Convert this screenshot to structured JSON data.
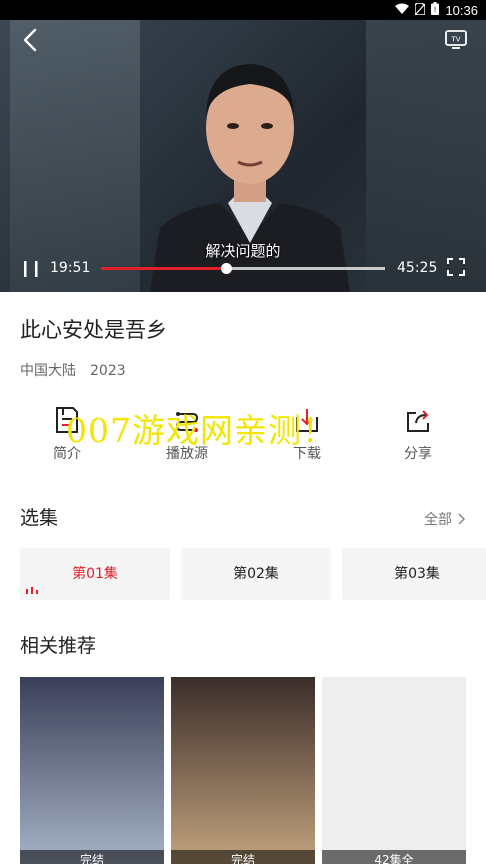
{
  "status_bar": {
    "time": "10:36"
  },
  "player": {
    "subtitle": "解决问题的",
    "current_time": "19:51",
    "duration": "45:25",
    "progress": 0.44,
    "accent": "#e0202a"
  },
  "show": {
    "title": "此心安处是吾乡",
    "region": "中国大陆",
    "year": "2023"
  },
  "actions": [
    {
      "label": "简介",
      "icon": "info-icon"
    },
    {
      "label": "播放源",
      "icon": "source-icon"
    },
    {
      "label": "下载",
      "icon": "download-icon"
    },
    {
      "label": "分享",
      "icon": "share-icon"
    }
  ],
  "watermark": "007游戏网亲测！",
  "episodes": {
    "heading": "选集",
    "all_label": "全部",
    "items": [
      {
        "label": "第01集",
        "active": true
      },
      {
        "label": "第02集",
        "active": false
      },
      {
        "label": "第03集",
        "active": false
      }
    ]
  },
  "recommendations": {
    "heading": "相关推荐",
    "items": [
      {
        "badge": "完结",
        "colors": [
          "#3a3f57",
          "#a7b3c7"
        ]
      },
      {
        "badge": "完结",
        "colors": [
          "#3b2d2a",
          "#c2a37d"
        ]
      },
      {
        "badge": "42集全",
        "colors": [
          "#eeeeee",
          "#eeeeee"
        ]
      }
    ]
  }
}
